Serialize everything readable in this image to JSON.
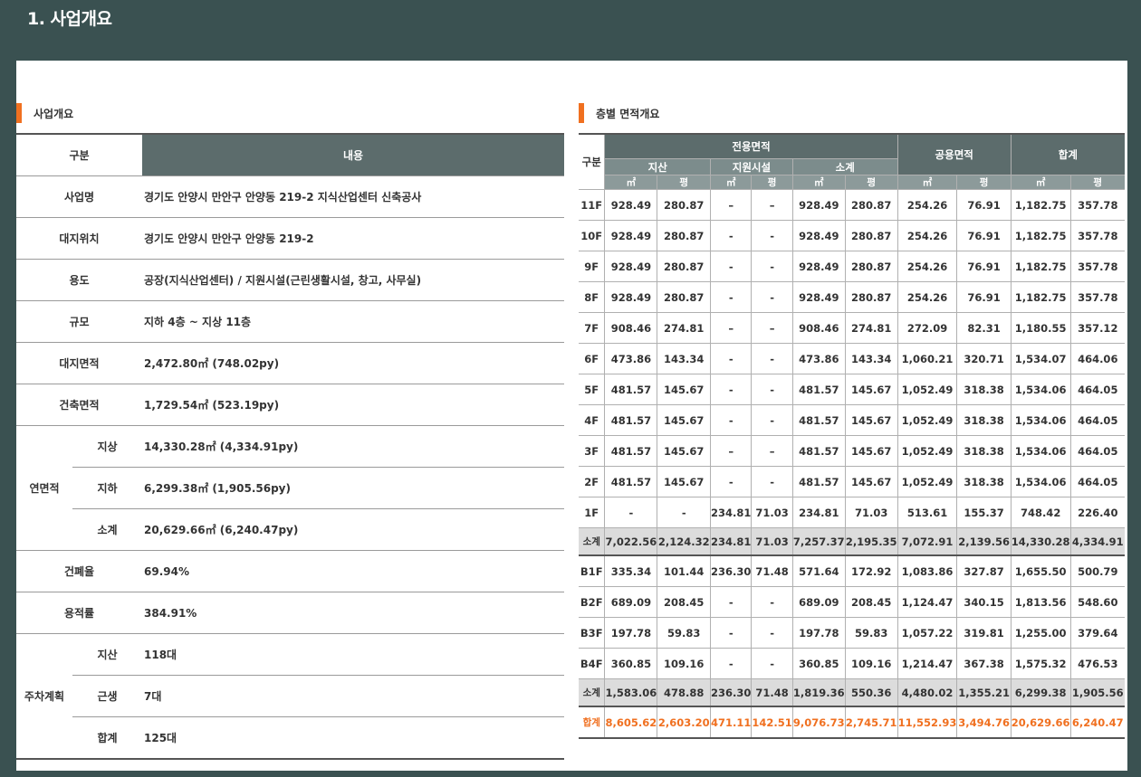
{
  "page_title": "1. 사업개요",
  "left_section": {
    "title": "사업개요",
    "header": {
      "col1": "구분",
      "col2": "내용"
    },
    "rows": [
      {
        "label": "사업명",
        "value": "경기도 안양시 만안구 안양동 219-2 지식산업센터 신축공사"
      },
      {
        "label": "대지위치",
        "value": "경기도 안양시 만안구 안양동 219-2"
      },
      {
        "label": "용도",
        "value": "공장(지식산업센터) / 지원시설(근린생활시설, 창고, 사무실)"
      },
      {
        "label": "규모",
        "value": "지하 4층 ~ 지상 11층"
      },
      {
        "label": "대지면적",
        "value": "2,472.80㎡ (748.02py)"
      },
      {
        "label": "건축면적",
        "value": "1,729.54㎡ (523.19py)"
      }
    ],
    "gross_area": {
      "label": "연면적",
      "rows": [
        {
          "sub": "지상",
          "value": "14,330.28㎡ (4,334.91py)"
        },
        {
          "sub": "지하",
          "value": "6,299.38㎡ (1,905.56py)"
        },
        {
          "sub": "소계",
          "value": "20,629.66㎡ (6,240.47py)"
        }
      ]
    },
    "ratios": [
      {
        "label": "건폐율",
        "value": "69.94%"
      },
      {
        "label": "용적률",
        "value": "384.91%"
      }
    ],
    "parking": {
      "label": "주차계획",
      "rows": [
        {
          "sub": "지산",
          "value": "118대"
        },
        {
          "sub": "근생",
          "value": "7대"
        },
        {
          "sub": "합계",
          "value": "125대"
        }
      ]
    }
  },
  "right_section": {
    "title": "층별 면적개요",
    "headers": {
      "gubun": "구분",
      "exclusive": "전용면적",
      "common": "공용면적",
      "total": "합계",
      "jisan": "지산",
      "support": "지원시설",
      "subtotal": "소계",
      "unit_m2": "㎡",
      "unit_py": "평"
    },
    "above_rows": [
      {
        "floor": "11F",
        "c": [
          "928.49",
          "280.87",
          "–",
          "–",
          "928.49",
          "280.87",
          "254.26",
          "76.91",
          "1,182.75",
          "357.78"
        ]
      },
      {
        "floor": "10F",
        "c": [
          "928.49",
          "280.87",
          "-",
          "-",
          "928.49",
          "280.87",
          "254.26",
          "76.91",
          "1,182.75",
          "357.78"
        ]
      },
      {
        "floor": "9F",
        "c": [
          "928.49",
          "280.87",
          "-",
          "-",
          "928.49",
          "280.87",
          "254.26",
          "76.91",
          "1,182.75",
          "357.78"
        ]
      },
      {
        "floor": "8F",
        "c": [
          "928.49",
          "280.87",
          "-",
          "-",
          "928.49",
          "280.87",
          "254.26",
          "76.91",
          "1,182.75",
          "357.78"
        ]
      },
      {
        "floor": "7F",
        "c": [
          "908.46",
          "274.81",
          "–",
          "–",
          "908.46",
          "274.81",
          "272.09",
          "82.31",
          "1,180.55",
          "357.12"
        ]
      },
      {
        "floor": "6F",
        "c": [
          "473.86",
          "143.34",
          "-",
          "-",
          "473.86",
          "143.34",
          "1,060.21",
          "320.71",
          "1,534.07",
          "464.06"
        ]
      },
      {
        "floor": "5F",
        "c": [
          "481.57",
          "145.67",
          "-",
          "-",
          "481.57",
          "145.67",
          "1,052.49",
          "318.38",
          "1,534.06",
          "464.05"
        ]
      },
      {
        "floor": "4F",
        "c": [
          "481.57",
          "145.67",
          "-",
          "-",
          "481.57",
          "145.67",
          "1,052.49",
          "318.38",
          "1,534.06",
          "464.05"
        ]
      },
      {
        "floor": "3F",
        "c": [
          "481.57",
          "145.67",
          "–",
          "–",
          "481.57",
          "145.67",
          "1,052.49",
          "318.38",
          "1,534.06",
          "464.05"
        ]
      },
      {
        "floor": "2F",
        "c": [
          "481.57",
          "145.67",
          "-",
          "-",
          "481.57",
          "145.67",
          "1,052.49",
          "318.38",
          "1,534.06",
          "464.05"
        ]
      },
      {
        "floor": "1F",
        "c": [
          "-",
          "-",
          "234.81",
          "71.03",
          "234.81",
          "71.03",
          "513.61",
          "155.37",
          "748.42",
          "226.40"
        ]
      }
    ],
    "above_subtotal": {
      "floor": "소계",
      "c": [
        "7,022.56",
        "2,124.32",
        "234.81",
        "71.03",
        "7,257.37",
        "2,195.35",
        "7,072.91",
        "2,139.56",
        "14,330.28",
        "4,334.91"
      ]
    },
    "below_rows": [
      {
        "floor": "B1F",
        "c": [
          "335.34",
          "101.44",
          "236.30",
          "71.48",
          "571.64",
          "172.92",
          "1,083.86",
          "327.87",
          "1,655.50",
          "500.79"
        ]
      },
      {
        "floor": "B2F",
        "c": [
          "689.09",
          "208.45",
          "-",
          "-",
          "689.09",
          "208.45",
          "1,124.47",
          "340.15",
          "1,813.56",
          "548.60"
        ]
      },
      {
        "floor": "B3F",
        "c": [
          "197.78",
          "59.83",
          "-",
          "-",
          "197.78",
          "59.83",
          "1,057.22",
          "319.81",
          "1,255.00",
          "379.64"
        ]
      },
      {
        "floor": "B4F",
        "c": [
          "360.85",
          "109.16",
          "-",
          "-",
          "360.85",
          "109.16",
          "1,214.47",
          "367.38",
          "1,575.32",
          "476.53"
        ]
      }
    ],
    "below_subtotal": {
      "floor": "소계",
      "c": [
        "1,583.06",
        "478.88",
        "236.30",
        "71.48",
        "1,819.36",
        "550.36",
        "4,480.02",
        "1,355.21",
        "6,299.38",
        "1,905.56"
      ]
    },
    "grand_total": {
      "floor": "합계",
      "c": [
        "8,605.62",
        "2,603.20",
        "471.11",
        "142.51",
        "9,076.73",
        "2,745.71",
        "11,552.93",
        "3,494.76",
        "20,629.66",
        "6,240.47"
      ]
    }
  },
  "colors": {
    "background": "#3a5151",
    "accent": "#f07020",
    "header": "#5c6c6c"
  }
}
